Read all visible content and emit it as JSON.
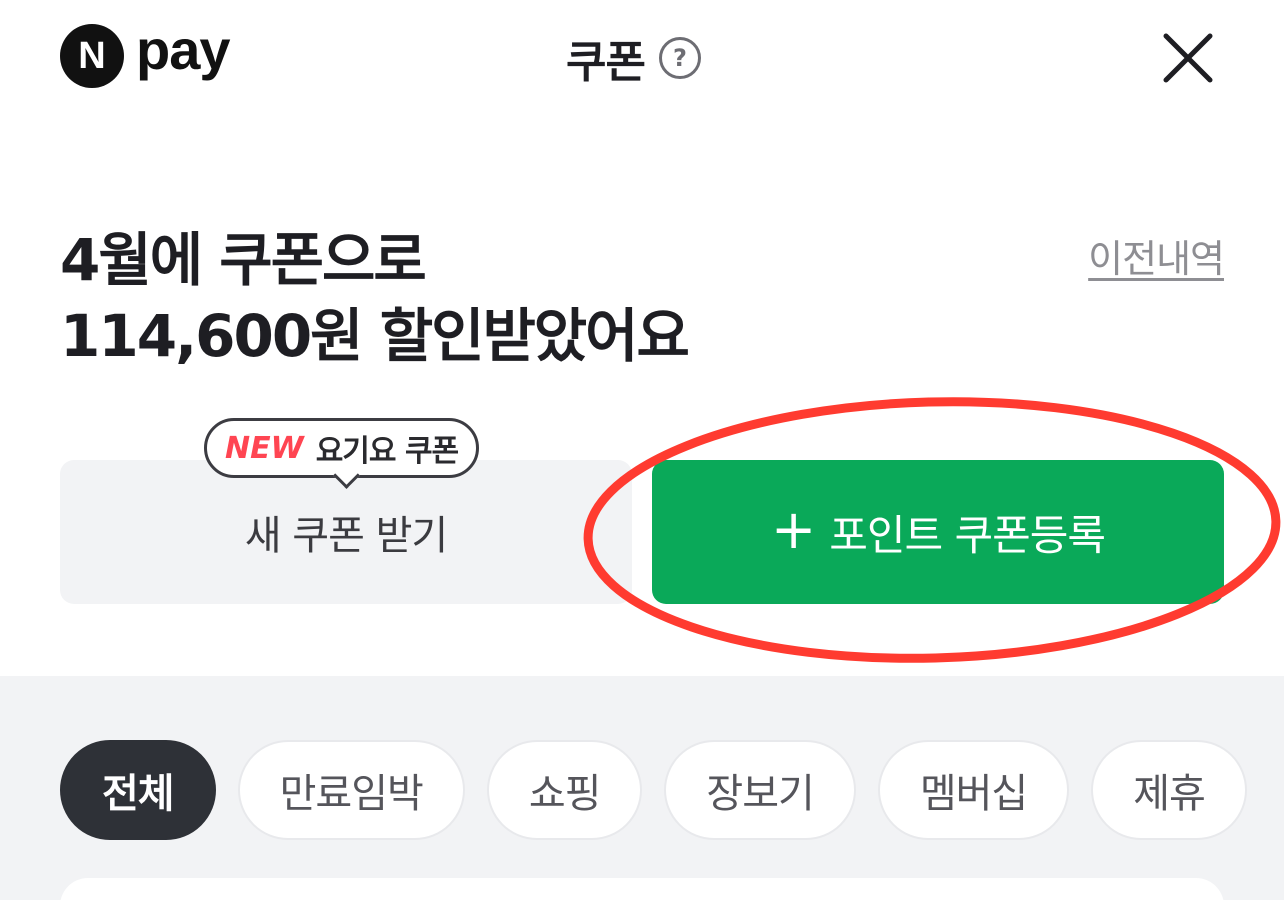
{
  "header": {
    "logo_mark": "N",
    "logo_text": "pay",
    "title": "쿠폰",
    "help_glyph": "?"
  },
  "summary": {
    "line1": "4월에 쿠폰으로",
    "line2": "114,600원 할인받았어요",
    "history_link": "이전내역"
  },
  "actions": {
    "new_coupon": {
      "label": "새 쿠폰 받기",
      "tooltip_badge": "NEW",
      "tooltip_text": "요기요 쿠폰"
    },
    "register": {
      "plus": "+",
      "label": "포인트 쿠폰등록"
    }
  },
  "filters": [
    {
      "label": "전체",
      "active": true
    },
    {
      "label": "만료임박",
      "active": false
    },
    {
      "label": "쇼핑",
      "active": false
    },
    {
      "label": "장보기",
      "active": false
    },
    {
      "label": "멤버십",
      "active": false
    },
    {
      "label": "제휴",
      "active": false
    }
  ],
  "colors": {
    "register_button": "#0aa959",
    "annotation": "#ff3b30",
    "new_badge": "#ff4552",
    "active_chip": "#2e3137"
  }
}
